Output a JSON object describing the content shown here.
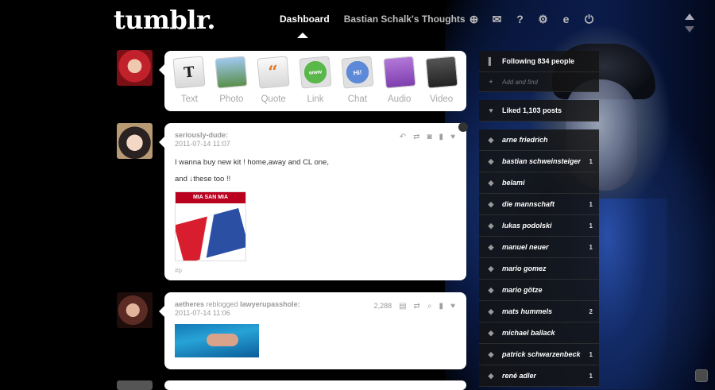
{
  "brand": {
    "logo": "tumblr."
  },
  "nav": {
    "dashboard": "Dashboard",
    "blog": "Bastian Schalk's Thoughts",
    "icons": [
      "plus-icon",
      "mail-icon",
      "help-icon",
      "gear-icon",
      "edit-icon",
      "power-icon"
    ]
  },
  "composer": {
    "types": [
      {
        "label": "Text",
        "glyph": "T"
      },
      {
        "label": "Photo",
        "glyph": ""
      },
      {
        "label": "Quote",
        "glyph": "“"
      },
      {
        "label": "Link",
        "glyph": "www"
      },
      {
        "label": "Chat",
        "glyph": "Hi!"
      },
      {
        "label": "Audio",
        "glyph": ""
      },
      {
        "label": "Video",
        "glyph": ""
      }
    ]
  },
  "posts": [
    {
      "author": "seriously-dude:",
      "date": "2011-07-14 11:07",
      "line1": "I wanna buy new kit ! home,away and CL one,",
      "line2": "and ↓these too !!",
      "image_banner": "MIA SAN MIA",
      "tag": "#p"
    },
    {
      "author": "aetheres",
      "reblog_text": "reblogged",
      "source": "lawyerupasshole:",
      "date": "2011-07-14 11:06",
      "notes": "2,288"
    }
  ],
  "sidebar": {
    "following": "Following 834 people",
    "add_friends": "Add and find",
    "liked": "Liked 1,103 posts",
    "tags": [
      {
        "name": "arne friedrich",
        "count": ""
      },
      {
        "name": "bastian schweinsteiger",
        "count": "1"
      },
      {
        "name": "belami",
        "count": ""
      },
      {
        "name": "die mannschaft",
        "count": "1"
      },
      {
        "name": "lukas podolski",
        "count": "1"
      },
      {
        "name": "manuel neuer",
        "count": "1"
      },
      {
        "name": "mario gomez",
        "count": ""
      },
      {
        "name": "mario götze",
        "count": ""
      },
      {
        "name": "mats hummels",
        "count": "2"
      },
      {
        "name": "michael ballack",
        "count": ""
      },
      {
        "name": "patrick schwarzenbeck",
        "count": "1"
      },
      {
        "name": "rené adler",
        "count": "1"
      }
    ]
  }
}
